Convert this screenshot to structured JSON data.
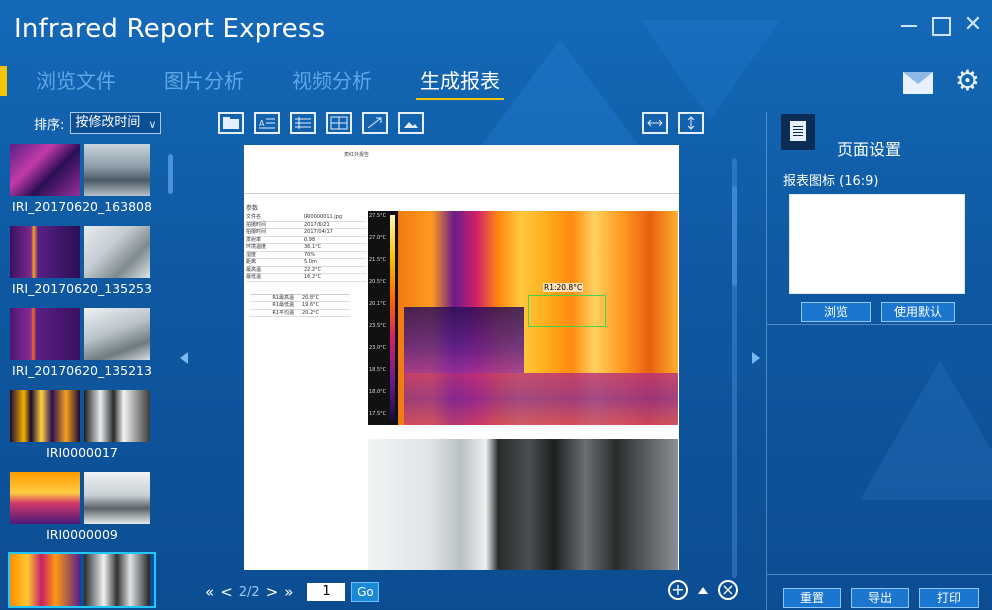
{
  "app": {
    "title": "Infrared Report Express"
  },
  "nav": {
    "tabs": [
      {
        "label": "浏览文件",
        "active": false
      },
      {
        "label": "图片分析",
        "active": false
      },
      {
        "label": "视频分析",
        "active": false
      },
      {
        "label": "生成报表",
        "active": true
      }
    ],
    "accent_color": "#f4c400"
  },
  "sidebar": {
    "sort_label": "排序:",
    "sort_value": "按修改时间",
    "files": [
      {
        "name": "IRI_20170620_163808",
        "selected": false
      },
      {
        "name": "IRI_20170620_135253",
        "selected": false
      },
      {
        "name": "IRI_20170620_135213",
        "selected": false
      },
      {
        "name": "IRI0000017",
        "selected": false
      },
      {
        "name": "IRI0000009",
        "selected": false
      },
      {
        "name": "",
        "selected": true
      }
    ]
  },
  "document": {
    "header_title": "表红外报告",
    "params": {
      "heading": "参数",
      "rows": [
        {
          "k": "文件名",
          "v": "IRI0000011.jpg"
        },
        {
          "k": "拍摄时间",
          "v": "2017/6/21"
        },
        {
          "k": "拍摄时间",
          "v": "2017/04/17"
        },
        {
          "k": "发射率",
          "v": "0.98"
        },
        {
          "k": "环境温度",
          "v": "36.1°C"
        },
        {
          "k": "湿度",
          "v": "70%"
        },
        {
          "k": "距离",
          "v": "5.0m"
        },
        {
          "k": "最高温",
          "v": "22.2°C"
        },
        {
          "k": "最低温",
          "v": "16.2°C"
        }
      ],
      "region_rows": [
        {
          "k": "R1最高温",
          "v": "20.8°C"
        },
        {
          "k": "R1最低温",
          "v": "19.6°C"
        },
        {
          "k": "R1平均温",
          "v": "20.2°C"
        }
      ]
    },
    "ir_scale_ticks": [
      "27.5°C",
      "27.0°C",
      "21.5°C",
      "20.5°C",
      "20.1°C",
      "23.5°C",
      "23.0°C",
      "18.5°C",
      "18.0°C",
      "17.5°C"
    ],
    "marker_label": "R1:20.8°C"
  },
  "pager": {
    "first": "«",
    "prev": "<",
    "page_text": "2/2",
    "next": ">",
    "last": "»",
    "page_input": "1",
    "go": "Go"
  },
  "zoom": {
    "in": "+",
    "close": "×"
  },
  "right_panel": {
    "title": "页面设置",
    "logo_label": "报表图标 (16:9)",
    "browse": "浏览",
    "use_default": "使用默认",
    "reset": "重置",
    "export": "导出",
    "print": "打印"
  },
  "window": {
    "minimize": "",
    "maximize": "",
    "close": "✕"
  }
}
